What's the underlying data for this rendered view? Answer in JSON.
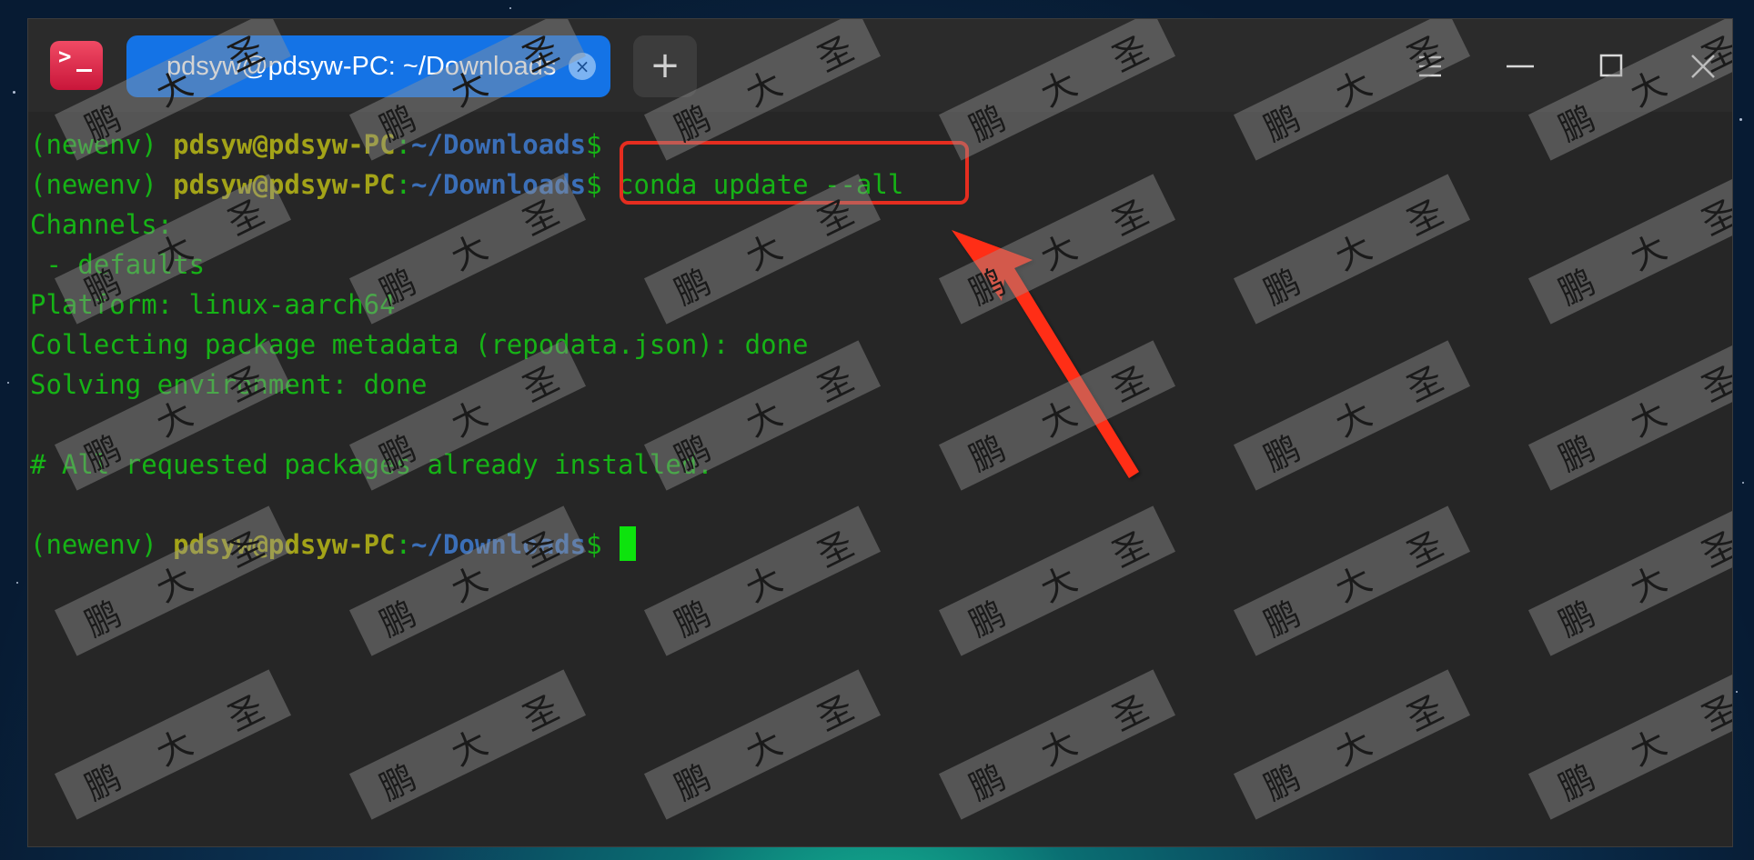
{
  "window": {
    "app_icon": "terminal-icon",
    "tab_title": "pdsyw@pdsyw-PC: ~/Downloads",
    "tab_close_icon": "×",
    "new_tab_icon": "+",
    "controls": [
      "menu-icon",
      "minimize-icon",
      "maximize-icon",
      "close-icon"
    ]
  },
  "terminal": {
    "prompt_env": "(newenv) ",
    "prompt_user": "pdsyw@pdsyw-PC",
    "prompt_colon": ":",
    "prompt_path": "~/Downloads",
    "prompt_dollar": "$ ",
    "command": "conda update --all",
    "output": [
      "Channels:",
      " - defaults",
      "Platform: linux-aarch64",
      "Collecting package metadata (repodata.json): done",
      "Solving environment: done",
      "",
      "# All requested packages already installed.",
      ""
    ]
  },
  "watermark": {
    "chars": [
      "鹏",
      "大",
      "圣"
    ]
  },
  "colors": {
    "terminal_bg": "#262626",
    "output_green": "#16b316",
    "user_yellow": "#a3a318",
    "path_blue": "#3b6fb8",
    "tab_blue": "#1473e6",
    "annotation_red": "#e52d1f"
  }
}
